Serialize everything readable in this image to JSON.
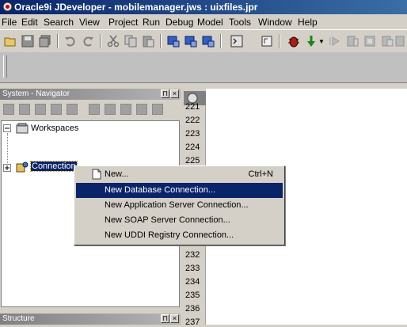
{
  "window": {
    "title": "Oracle9i JDeveloper - mobilemanager.jws : uixfiles.jpr"
  },
  "menubar": {
    "items": [
      "File",
      "Edit",
      "Search",
      "View",
      "Project",
      "Run",
      "Debug",
      "Model",
      "Tools",
      "Window",
      "Help"
    ]
  },
  "toolbar": {
    "icons": [
      "open-icon",
      "save-icon",
      "save-all-icon",
      "undo-icon",
      "redo-icon",
      "cut-icon",
      "copy-icon",
      "paste-icon",
      "make-icon",
      "rebuild-icon",
      "deploy-icon",
      "toggle-view-icon",
      "class-icon",
      "debug-icon",
      "run-icon",
      "step-icon",
      "step-over-icon",
      "step-out-icon",
      "watch-icon"
    ]
  },
  "navigator": {
    "title": "System - Navigator",
    "tree": {
      "workspaces_label": "Workspaces",
      "connections_label": "Connection"
    }
  },
  "structure": {
    "title": "Structure"
  },
  "editor": {
    "line_numbers_top": [
      "221",
      "222",
      "223",
      "224",
      "225"
    ],
    "line_numbers_bottom": [
      "232",
      "233",
      "234",
      "235",
      "236",
      "237"
    ]
  },
  "context_menu": {
    "items": [
      {
        "label": "New...",
        "shortcut": "Ctrl+N"
      },
      {
        "label": "New Database Connection...",
        "shortcut": ""
      },
      {
        "label": "New Application Server Connection...",
        "shortcut": ""
      },
      {
        "label": "New SOAP Server Connection...",
        "shortcut": ""
      },
      {
        "label": "New UDDI Registry Connection...",
        "shortcut": ""
      }
    ],
    "selected_index": 1
  },
  "colors": {
    "title_bar": "#0a246a",
    "selection": "#0a246a",
    "face": "#d4d0c8"
  }
}
